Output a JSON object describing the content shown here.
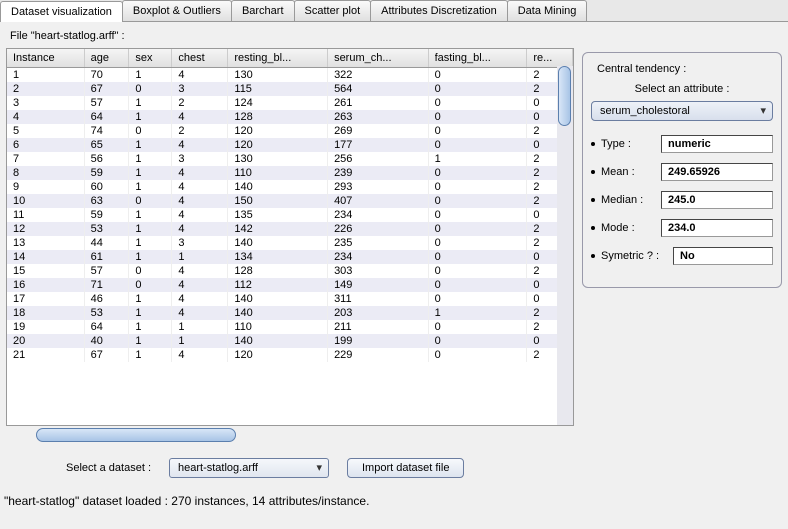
{
  "tabs": [
    "Dataset visualization",
    "Boxplot & Outliers",
    "Barchart",
    "Scatter plot",
    "Attributes Discretization",
    "Data Mining"
  ],
  "active_tab_index": 0,
  "file_label": "File \"heart-statlog.arff\" :",
  "columns": [
    "Instance",
    "age",
    "sex",
    "chest",
    "resting_bl...",
    "serum_ch...",
    "fasting_bl...",
    "re..."
  ],
  "rows": [
    [
      "1",
      "70",
      "1",
      "4",
      "130",
      "322",
      "0",
      "2"
    ],
    [
      "2",
      "67",
      "0",
      "3",
      "115",
      "564",
      "0",
      "2"
    ],
    [
      "3",
      "57",
      "1",
      "2",
      "124",
      "261",
      "0",
      "0"
    ],
    [
      "4",
      "64",
      "1",
      "4",
      "128",
      "263",
      "0",
      "0"
    ],
    [
      "5",
      "74",
      "0",
      "2",
      "120",
      "269",
      "0",
      "2"
    ],
    [
      "6",
      "65",
      "1",
      "4",
      "120",
      "177",
      "0",
      "0"
    ],
    [
      "7",
      "56",
      "1",
      "3",
      "130",
      "256",
      "1",
      "2"
    ],
    [
      "8",
      "59",
      "1",
      "4",
      "110",
      "239",
      "0",
      "2"
    ],
    [
      "9",
      "60",
      "1",
      "4",
      "140",
      "293",
      "0",
      "2"
    ],
    [
      "10",
      "63",
      "0",
      "4",
      "150",
      "407",
      "0",
      "2"
    ],
    [
      "11",
      "59",
      "1",
      "4",
      "135",
      "234",
      "0",
      "0"
    ],
    [
      "12",
      "53",
      "1",
      "4",
      "142",
      "226",
      "0",
      "2"
    ],
    [
      "13",
      "44",
      "1",
      "3",
      "140",
      "235",
      "0",
      "2"
    ],
    [
      "14",
      "61",
      "1",
      "1",
      "134",
      "234",
      "0",
      "0"
    ],
    [
      "15",
      "57",
      "0",
      "4",
      "128",
      "303",
      "0",
      "2"
    ],
    [
      "16",
      "71",
      "0",
      "4",
      "112",
      "149",
      "0",
      "0"
    ],
    [
      "17",
      "46",
      "1",
      "4",
      "140",
      "311",
      "0",
      "0"
    ],
    [
      "18",
      "53",
      "1",
      "4",
      "140",
      "203",
      "1",
      "2"
    ],
    [
      "19",
      "64",
      "1",
      "1",
      "110",
      "211",
      "0",
      "2"
    ],
    [
      "20",
      "40",
      "1",
      "1",
      "140",
      "199",
      "0",
      "0"
    ],
    [
      "21",
      "67",
      "1",
      "4",
      "120",
      "229",
      "0",
      "2"
    ]
  ],
  "central": {
    "title": "Central tendency :",
    "select_label": "Select an attribute :",
    "selected_attribute": "serum_cholestoral",
    "type_label": "Type :",
    "type_value": "numeric",
    "mean_label": "Mean :",
    "mean_value": "249.65926",
    "median_label": "Median :",
    "median_value": "245.0",
    "mode_label": "Mode :",
    "mode_value": "234.0",
    "sym_label": "Symetric ? :",
    "sym_value": "No"
  },
  "bottom": {
    "select_label": "Select a dataset :",
    "select_value": "heart-statlog.arff",
    "import_btn": "Import dataset file"
  },
  "status": "\"heart-statlog\" dataset loaded :  270 instances,  14 attributes/instance."
}
